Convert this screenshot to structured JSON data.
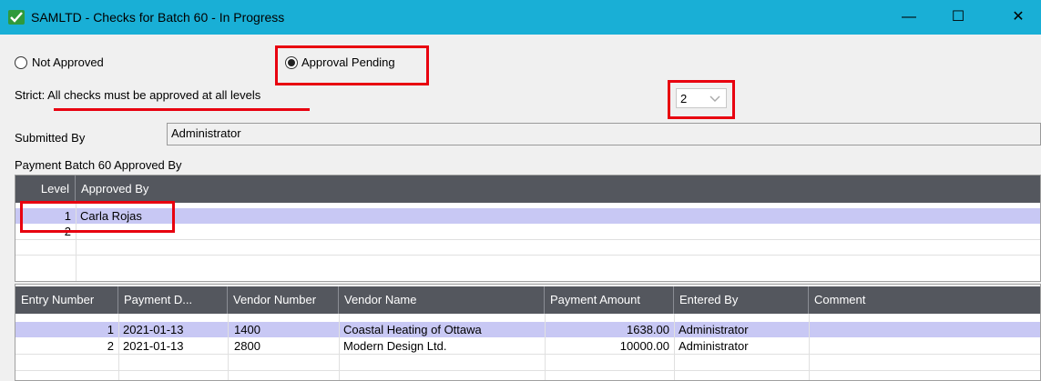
{
  "window": {
    "title": "SAMLTD - Checks for Batch 60 - In Progress",
    "minimize_glyph": "—",
    "maximize_glyph": "☐",
    "close_glyph": "✕"
  },
  "approval_status": {
    "options": [
      "Not Approved",
      "Approval Pending"
    ],
    "selected": "Approval Pending"
  },
  "strict": {
    "text": "Strict: All checks must be approved at all levels"
  },
  "level_select": {
    "value": "2"
  },
  "submitted_by": {
    "label": "Submitted By",
    "value": "Administrator"
  },
  "approvals": {
    "label": "Payment Batch 60 Approved By",
    "columns": [
      "Level",
      "Approved By"
    ],
    "rows": [
      {
        "level": "1",
        "approved_by": "Carla Rojas"
      },
      {
        "level": "2",
        "approved_by": ""
      }
    ]
  },
  "checks": {
    "columns": [
      "Entry Number",
      "Payment D...",
      "Vendor Number",
      "Vendor Name",
      "Payment Amount",
      "Entered By",
      "Comment"
    ],
    "rows": [
      {
        "entry": "1",
        "date": "2021-01-13",
        "vendor_number": "1400",
        "vendor_name": "Coastal Heating of Ottawa",
        "amount": "1638.00",
        "entered_by": "Administrator",
        "comment": ""
      },
      {
        "entry": "2",
        "date": "2021-01-13",
        "vendor_number": "2800",
        "vendor_name": "Modern Design Ltd.",
        "amount": "10000.00",
        "entered_by": "Administrator",
        "comment": ""
      }
    ]
  },
  "colors": {
    "titlebar": "#19afd6",
    "grid_header": "#54575e",
    "selected_row": "#c8c8f4",
    "highlight": "#e8000f"
  }
}
